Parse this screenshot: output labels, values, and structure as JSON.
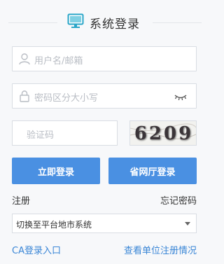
{
  "header": {
    "title": "系统登录",
    "icon": "monitor-icon",
    "icon_color": "#2aa6c8"
  },
  "username": {
    "placeholder": "用户名/邮箱",
    "icon": "user-icon"
  },
  "password": {
    "placeholder": "密码区分大小写",
    "icon": "lock-icon",
    "toggle_icon": "eye-closed-icon"
  },
  "captcha": {
    "placeholder": "验证码",
    "code": "6209"
  },
  "buttons": {
    "login": "立即登录",
    "province_login": "省网厅登录",
    "color": "#4a90e2"
  },
  "links": {
    "register": "注册",
    "forgot_password": "忘记密码",
    "ca_login": "CA登录入口",
    "check_registration": "查看单位注册情况",
    "link_color": "#3a86d6"
  },
  "platform_select": {
    "selected": "切换至平台地市系统"
  }
}
